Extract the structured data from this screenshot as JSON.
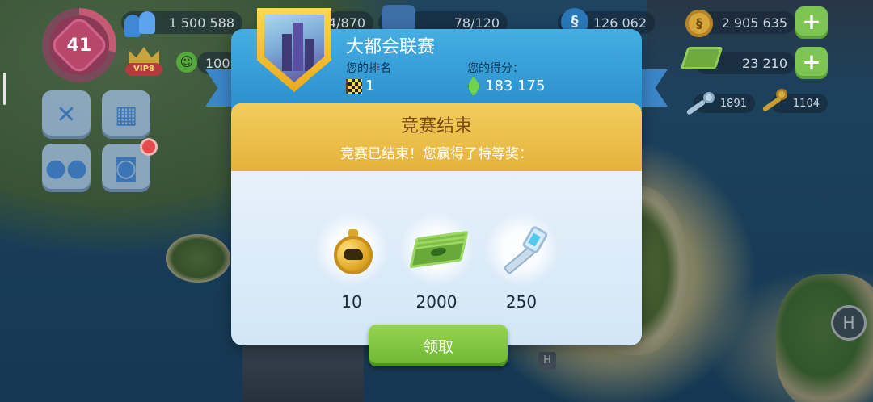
{
  "hud": {
    "level": "41",
    "population": "1 500 588",
    "mood": "100",
    "vip_label": "VIP8",
    "storage_partial": "4/870",
    "storage": "78/120",
    "simcash": "126 062",
    "simcash_symbol": "§",
    "coins": "2 905 635",
    "coin_symbol": "§",
    "bills": "23 210",
    "platinum_keys": "1891",
    "golden_keys": "1104",
    "plus_symbol": "+"
  },
  "dialog": {
    "title": "大都会联赛",
    "rank_label": "您的排名",
    "rank_value": "1",
    "score_label": "您的得分：",
    "score_value": "183 175",
    "ended_title": "竞赛结束",
    "ended_subtitle": "竞赛已结束！您赢得了特等奖：",
    "rewards": [
      {
        "icon": "speedup-medal-icon",
        "value": "10"
      },
      {
        "icon": "simoleon-bills-icon",
        "value": "2000"
      },
      {
        "icon": "platinum-key-icon",
        "value": "250"
      }
    ],
    "claim_label": "领取"
  },
  "colors": {
    "header_blue": "#2a8fcd",
    "gold_band": "#e4b33b",
    "claim_green": "#6db733",
    "ended_title_color": "#7b4a13"
  }
}
